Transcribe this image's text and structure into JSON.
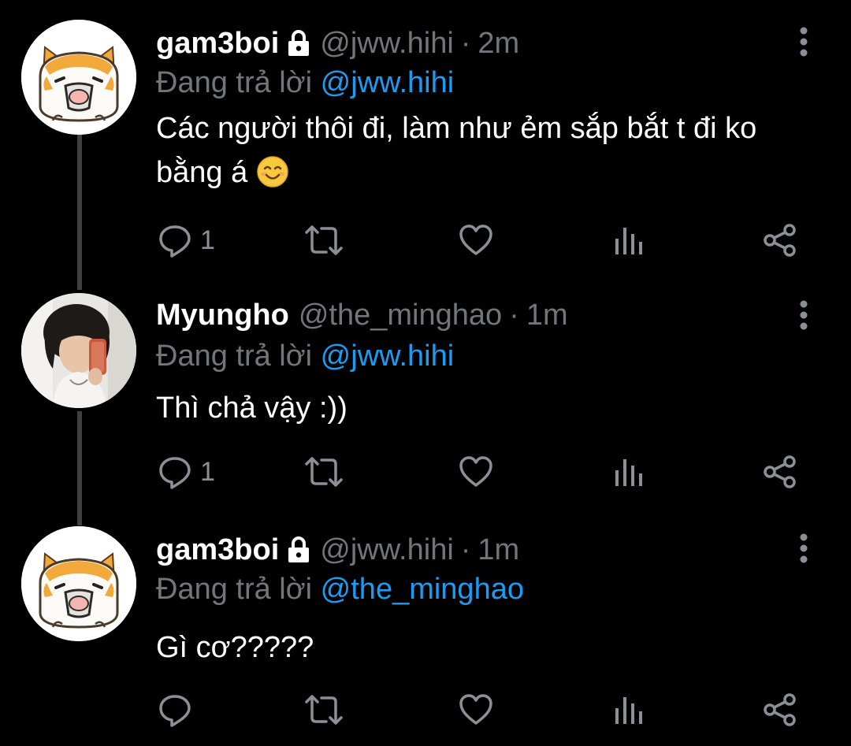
{
  "thread": {
    "tweets": [
      {
        "name": "gam3boi",
        "locked": true,
        "handle": "@jww.hihi",
        "separator": "·",
        "time": "2m",
        "replying_prefix": "Đang trả lời",
        "replying_to": "@jww.hihi",
        "text": "Các người thôi đi, làm như ẻm sắp bắt t đi ko bằng á",
        "emoji": "smiling-face-icon",
        "reply_count": "1",
        "avatar": "orange-white-cat-avatar"
      },
      {
        "name": "Myungho",
        "locked": false,
        "handle": "@the_minghao",
        "separator": "·",
        "time": "1m",
        "replying_prefix": "Đang trả lời",
        "replying_to": "@jww.hihi",
        "text": "Thì chả vậy :))",
        "reply_count": "1",
        "avatar": "mirror-selfie-photo-avatar"
      },
      {
        "name": "gam3boi",
        "locked": true,
        "handle": "@jww.hihi",
        "separator": "·",
        "time": "1m",
        "replying_prefix": "Đang trả lời",
        "replying_to": "@the_minghao",
        "text": "Gì cơ?????",
        "reply_count": "",
        "avatar": "orange-white-cat-avatar"
      }
    ]
  },
  "icons": {
    "actions": [
      "reply-icon",
      "retweet-icon",
      "like-icon",
      "analytics-icon",
      "share-icon"
    ],
    "menu": "more-vertical-icon",
    "lock": "lock-icon"
  },
  "colors": {
    "background": "#000000",
    "name": "#ffffff",
    "secondary": "#71767b",
    "mention": "#1d9bf0",
    "icon": "#8b9096",
    "thread_line": "#3e4144"
  }
}
